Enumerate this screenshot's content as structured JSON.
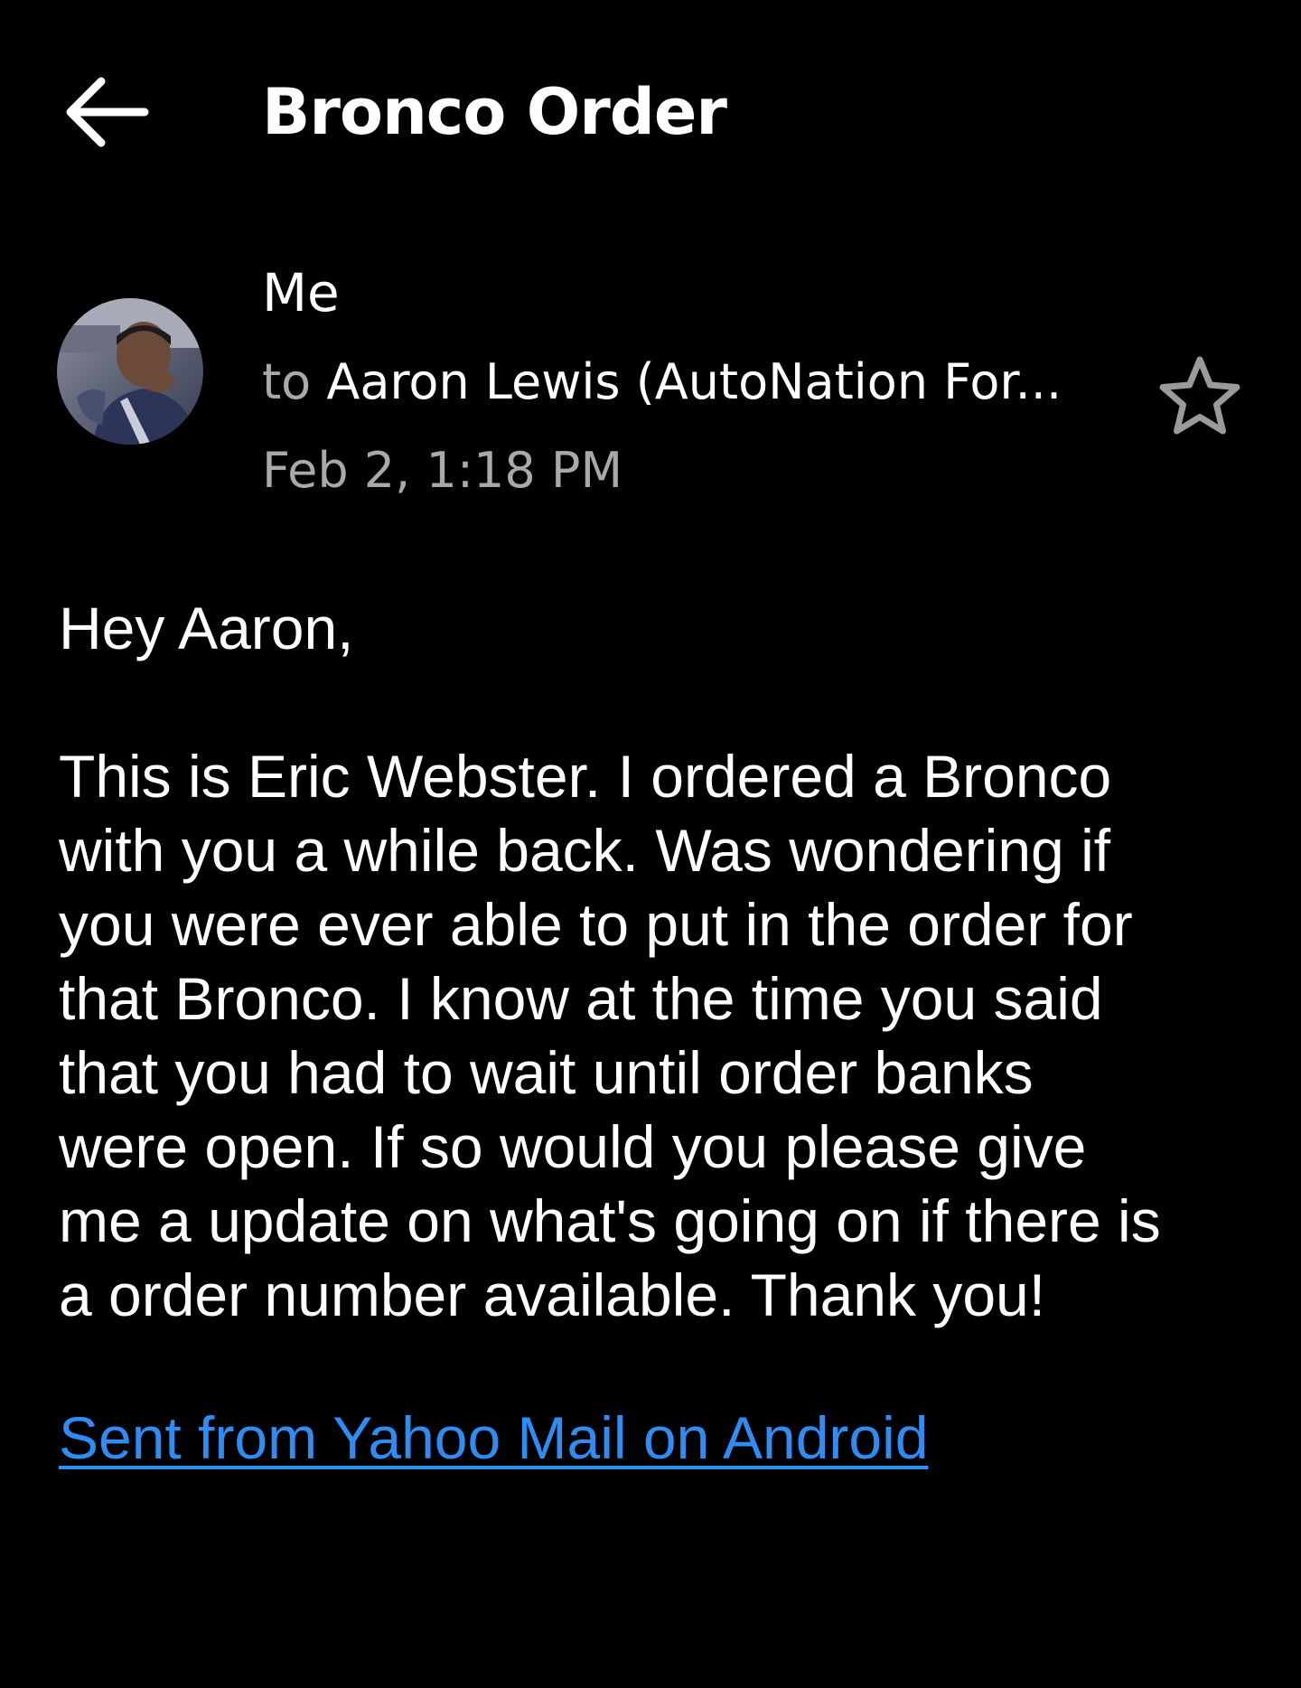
{
  "header": {
    "back_icon": "arrow-left-icon",
    "subject": "Bronco Order"
  },
  "message_meta": {
    "sender": "Me",
    "to_label": "to",
    "recipient": "Aaron Lewis (AutoNation For...",
    "date": "Feb 2, 1:18 PM",
    "star_icon": "star-outline-icon"
  },
  "body": {
    "greeting": "Hey Aaron,",
    "lines": [
      "This is Eric Webster. I ordered a Bronco",
      "with you a while back. Was wondering if",
      "you were ever able to put in the order for",
      "that Bronco. I know at the time you said",
      "that you had to wait until order banks",
      "were open. If so would you please give",
      "me a update on what's going on if there is",
      "a order number available. Thank you!"
    ],
    "signature": "Sent from Yahoo Mail on Android"
  },
  "colors": {
    "background": "#000000",
    "text": "#ffffff",
    "muted": "#a9a9a9",
    "link": "#2f8cf2",
    "star_outline": "#9a9a9a"
  }
}
